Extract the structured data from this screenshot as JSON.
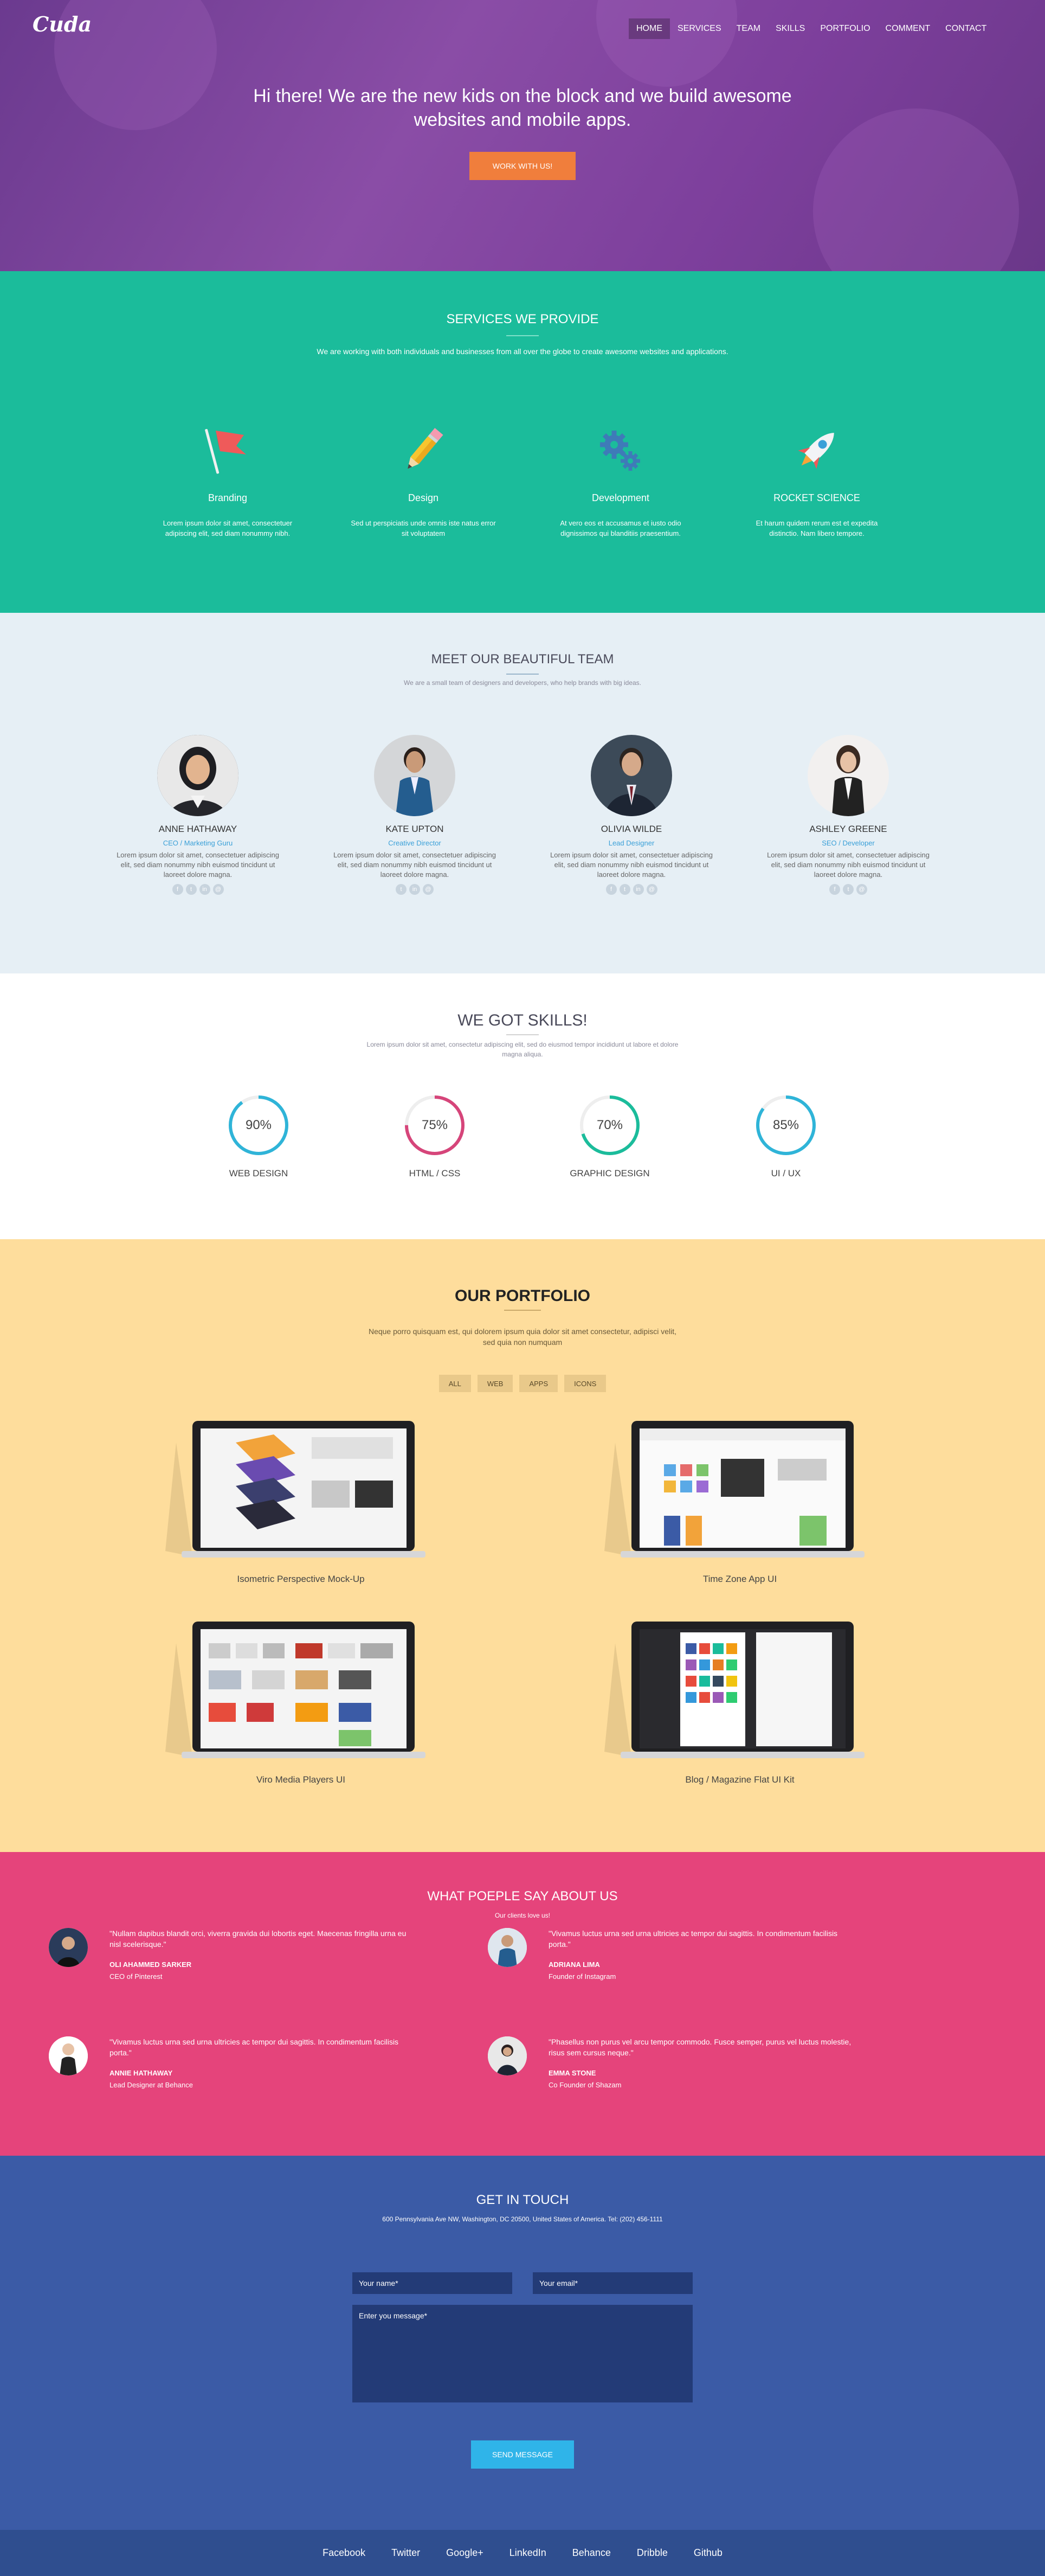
{
  "brand": {
    "logo": "Cuda"
  },
  "nav": {
    "items": [
      "HOME",
      "SERVICES",
      "TEAM",
      "SKILLS",
      "PORTFOLIO",
      "COMMENT",
      "CONTACT"
    ]
  },
  "hero": {
    "headline_line1": "Hi there! We are the new kids on the block and we build awesome",
    "headline_line2": "websites and mobile apps.",
    "cta": "WORK WITH US!"
  },
  "services": {
    "title": "SERVICES WE PROVIDE",
    "subtitle": "We are working with both individuals and businesses from all over the globe to create awesome websites and applications.",
    "items": [
      {
        "title": "Branding",
        "text": "Lorem ipsum dolor sit amet, consectetuer adipiscing elit, sed diam nonummy nibh.",
        "icon": "flag-icon"
      },
      {
        "title": "Design",
        "text": "Sed ut perspiciatis unde omnis iste natus error sit voluptatem",
        "icon": "pencil-icon"
      },
      {
        "title": "Development",
        "text": "At vero eos et accusamus et iusto odio dignissimos qui blanditiis praesentium.",
        "icon": "gears-icon"
      },
      {
        "title": "ROCKET SCIENCE",
        "text": "Et harum quidem rerum est et expedita distinctio. Nam libero tempore.",
        "icon": "rocket-icon"
      }
    ]
  },
  "team": {
    "title": "MEET OUR BEAUTIFUL TEAM",
    "subtitle": "We are a small team of designers and developers, who help brands with big ideas.",
    "members": [
      {
        "name": "ANNE HATHAWAY",
        "role": "CEO / Marketing Guru",
        "bio": "Lorem ipsum dolor sit amet, consectetuer adipiscing elit, sed diam nonummy nibh euismod tincidunt ut laoreet dolore magna."
      },
      {
        "name": "KATE UPTON",
        "role": "Creative Director",
        "bio": "Lorem ipsum dolor sit amet, consectetuer adipiscing elit, sed diam nonummy nibh euismod tincidunt ut laoreet dolore magna."
      },
      {
        "name": "OLIVIA WILDE",
        "role": "Lead Designer",
        "bio": "Lorem ipsum dolor sit amet, consectetuer adipiscing elit, sed diam nonummy nibh euismod tincidunt ut laoreet dolore magna."
      },
      {
        "name": "ASHLEY GREENE",
        "role": "SEO / Developer",
        "bio": "Lorem ipsum dolor sit amet, consectetuer adipiscing elit, sed diam nonummy nibh euismod tincidunt ut laoreet dolore magna."
      }
    ],
    "social_icons": [
      "facebook-icon",
      "twitter-icon",
      "linkedin-icon",
      "email-icon"
    ]
  },
  "skills": {
    "title": "WE GOT SKILLS!",
    "subtitle_line1": "Lorem ipsum dolor sit amet, consectetur adipiscing elit, sed do eiusmod tempor incididunt ut labore et dolore",
    "subtitle_line2": "magna aliqua.",
    "items": [
      {
        "label": "WEB DESIGN",
        "value": "90%",
        "pct": 90,
        "color": "#2fb4d8"
      },
      {
        "label": "HTML / CSS",
        "value": "75%",
        "pct": 75,
        "color": "#d6457a"
      },
      {
        "label": "GRAPHIC DESIGN",
        "value": "70%",
        "pct": 70,
        "color": "#1bbc9b"
      },
      {
        "label": "UI / UX",
        "value": "85%",
        "pct": 85,
        "color": "#2fb4d8"
      }
    ]
  },
  "portfolio": {
    "title": "OUR PORTFOLIO",
    "subtitle_line1": "Neque porro quisquam est, qui dolorem ipsum quia dolor sit amet consectetur, adipisci velit,",
    "subtitle_line2": "sed quia non numquam",
    "filters": [
      "ALL",
      "WEB",
      "APPS",
      "ICONS"
    ],
    "items": [
      "Isometric Perspective Mock-Up",
      "Time Zone App UI",
      "Viro Media Players UI",
      "Blog / Magazine Flat UI Kit"
    ]
  },
  "testimonials": {
    "title": "WHAT POEPLE SAY ABOUT US",
    "subtitle": "Our clients love us!",
    "items": [
      {
        "quote": "\"Nullam dapibus blandit orci, viverra gravida dui lobortis eget. Maecenas fringilla urna eu nisl scelerisque.\"",
        "name": "OLI AHAMMED SARKER",
        "title": "CEO of Pinterest"
      },
      {
        "quote": "\"Vivamus luctus urna sed urna ultricies ac tempor dui sagittis. In condimentum facilisis porta.\"",
        "name": "ADRIANA LIMA",
        "title": "Founder of Instagram"
      },
      {
        "quote": "\"Vivamus luctus urna sed urna ultricies ac tempor dui sagittis. In condimentum facilisis porta.\"",
        "name": "ANNIE HATHAWAY",
        "title": "Lead Designer at Behance"
      },
      {
        "quote": "\"Phasellus non purus vel arcu tempor commodo. Fusce semper, purus vel luctus molestie, risus sem cursus neque.\"",
        "name": "EMMA STONE",
        "title": "Co Founder of Shazam"
      }
    ]
  },
  "contact": {
    "title": "GET IN TOUCH",
    "address": "600 Pennsylvania Ave NW, Washington, DC 20500, United States of America. Tel: (202) 456-1111",
    "name_placeholder": "Your name*",
    "email_placeholder": "Your email*",
    "message_placeholder": "Enter you message*",
    "send": "SEND MESSAGE"
  },
  "footer": {
    "links": [
      "Facebook",
      "Twitter",
      "Google+",
      "LinkedIn",
      "Behance",
      "Dribble",
      "Github"
    ]
  },
  "colors": {
    "hero": "#7d3f9c",
    "services": "#1bbc9b",
    "team": "#e6eff5",
    "portfolio": "#fedd9c",
    "testimonials": "#e5447b",
    "contact": "#3b5ba6",
    "footer": "#2f4e8f",
    "accent_orange": "#f07e3c"
  }
}
